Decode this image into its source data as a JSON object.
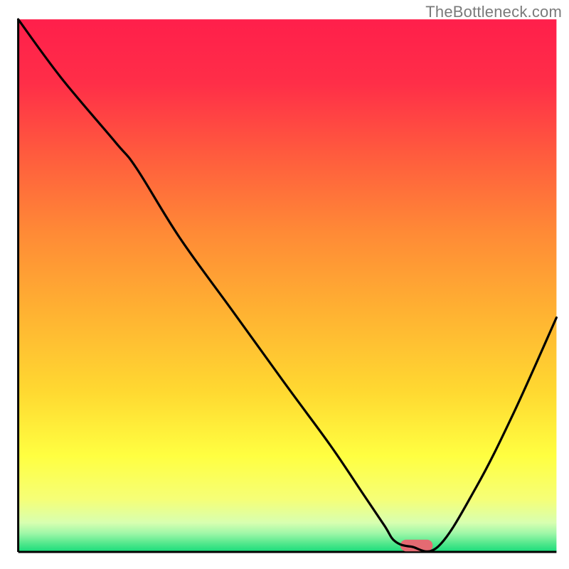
{
  "watermark": "TheBottleneck.com",
  "chart_data": {
    "type": "line",
    "title": "",
    "xlabel": "",
    "ylabel": "",
    "xlim": [
      0,
      100
    ],
    "ylim": [
      0,
      100
    ],
    "grid": false,
    "legend": false,
    "gradient_stops": [
      {
        "offset": 0.0,
        "color": "#ff1f4b"
      },
      {
        "offset": 0.12,
        "color": "#ff2e48"
      },
      {
        "offset": 0.25,
        "color": "#ff5a3e"
      },
      {
        "offset": 0.4,
        "color": "#ff8a36"
      },
      {
        "offset": 0.55,
        "color": "#ffb232"
      },
      {
        "offset": 0.7,
        "color": "#ffd931"
      },
      {
        "offset": 0.82,
        "color": "#ffff41"
      },
      {
        "offset": 0.9,
        "color": "#f6ff76"
      },
      {
        "offset": 0.945,
        "color": "#d8ffb0"
      },
      {
        "offset": 0.965,
        "color": "#9ff7a8"
      },
      {
        "offset": 0.985,
        "color": "#4fe78b"
      },
      {
        "offset": 1.0,
        "color": "#18db7b"
      }
    ],
    "series": [
      {
        "name": "bottleneck-curve",
        "x": [
          0,
          8,
          18,
          22,
          30,
          40,
          50,
          58,
          64,
          68,
          70,
          73,
          78,
          85,
          92,
          100
        ],
        "y": [
          100,
          89,
          77,
          72,
          59,
          45,
          31,
          20,
          11,
          5,
          2,
          1,
          1,
          12,
          26,
          44
        ]
      }
    ],
    "marker": {
      "name": "optimal-zone",
      "x_start": 71,
      "x_end": 77,
      "y": 1.2,
      "color": "#e46a72",
      "height": 2.2
    },
    "axes": {
      "left": {
        "x": 3.2,
        "y1": 3.4,
        "y2": 97.0
      },
      "bottom": {
        "y": 97.0,
        "x1": 3.2,
        "x2": 97.8
      }
    }
  }
}
